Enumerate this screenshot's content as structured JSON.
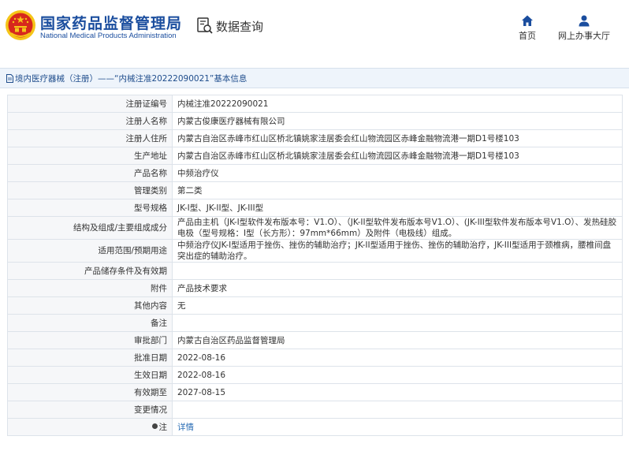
{
  "header": {
    "title": "国家药品监督管理局",
    "subtitle": "National Medical Products Administration",
    "query_label": "数据查询",
    "nav": [
      {
        "label": "首页",
        "icon": "home-icon"
      },
      {
        "label": "网上办事大厅",
        "icon": "user-icon"
      }
    ]
  },
  "breadcrumb": "境内医疗器械（注册）——“内械注准20222090021”基本信息",
  "rows": [
    {
      "label": "注册证编号",
      "value": "内械注准20222090021"
    },
    {
      "label": "注册人名称",
      "value": "内蒙古俊康医疗器械有限公司"
    },
    {
      "label": "注册人住所",
      "value": "内蒙古自治区赤峰市红山区桥北镇姚家洼居委会红山物流园区赤峰金融物流港一期D1号楼103"
    },
    {
      "label": "生产地址",
      "value": "内蒙古自治区赤峰市红山区桥北镇姚家洼居委会红山物流园区赤峰金融物流港一期D1号楼103"
    },
    {
      "label": "产品名称",
      "value": "中频治疗仪"
    },
    {
      "label": "管理类别",
      "value": "第二类"
    },
    {
      "label": "型号规格",
      "value": "JK-I型、JK-II型、JK-III型"
    },
    {
      "label": "结构及组成/主要组成成分",
      "value": "产品由主机（JK-I型软件发布版本号：V1.O）、（JK-II型软件发布版本号V1.O）、(JK-III型软件发布版本号V1.O）、发热硅胶电极（型号规格：I型（长方形）：97mm*66mm）及附件（电极线）组成。"
    },
    {
      "label": "适用范围/预期用途",
      "value": "中频治疗仪JK-I型适用于挫伤、挫伤的辅助治疗；JK-II型适用于挫伤、挫伤的辅助治疗，JK-III型适用于颈椎病，腰椎间盘突出症的辅助治疗。"
    },
    {
      "label": "产品储存条件及有效期",
      "value": ""
    },
    {
      "label": "附件",
      "value": "产品技术要求"
    },
    {
      "label": "其他内容",
      "value": "无"
    },
    {
      "label": "备注",
      "value": ""
    },
    {
      "label": "审批部门",
      "value": "内蒙古自治区药品监督管理局"
    },
    {
      "label": "批准日期",
      "value": "2022-08-16"
    },
    {
      "label": "生效日期",
      "value": "2022-08-16"
    },
    {
      "label": "有效期至",
      "value": "2027-08-15"
    },
    {
      "label": "变更情况",
      "value": ""
    },
    {
      "label": "注",
      "value": "详情"
    }
  ],
  "colors": {
    "brand_blue": "#1a4d9e",
    "link": "#2a6db5",
    "crumb_bg": "#eef4fb",
    "emblem_red": "#d7281d",
    "emblem_gold": "#f5c518"
  }
}
